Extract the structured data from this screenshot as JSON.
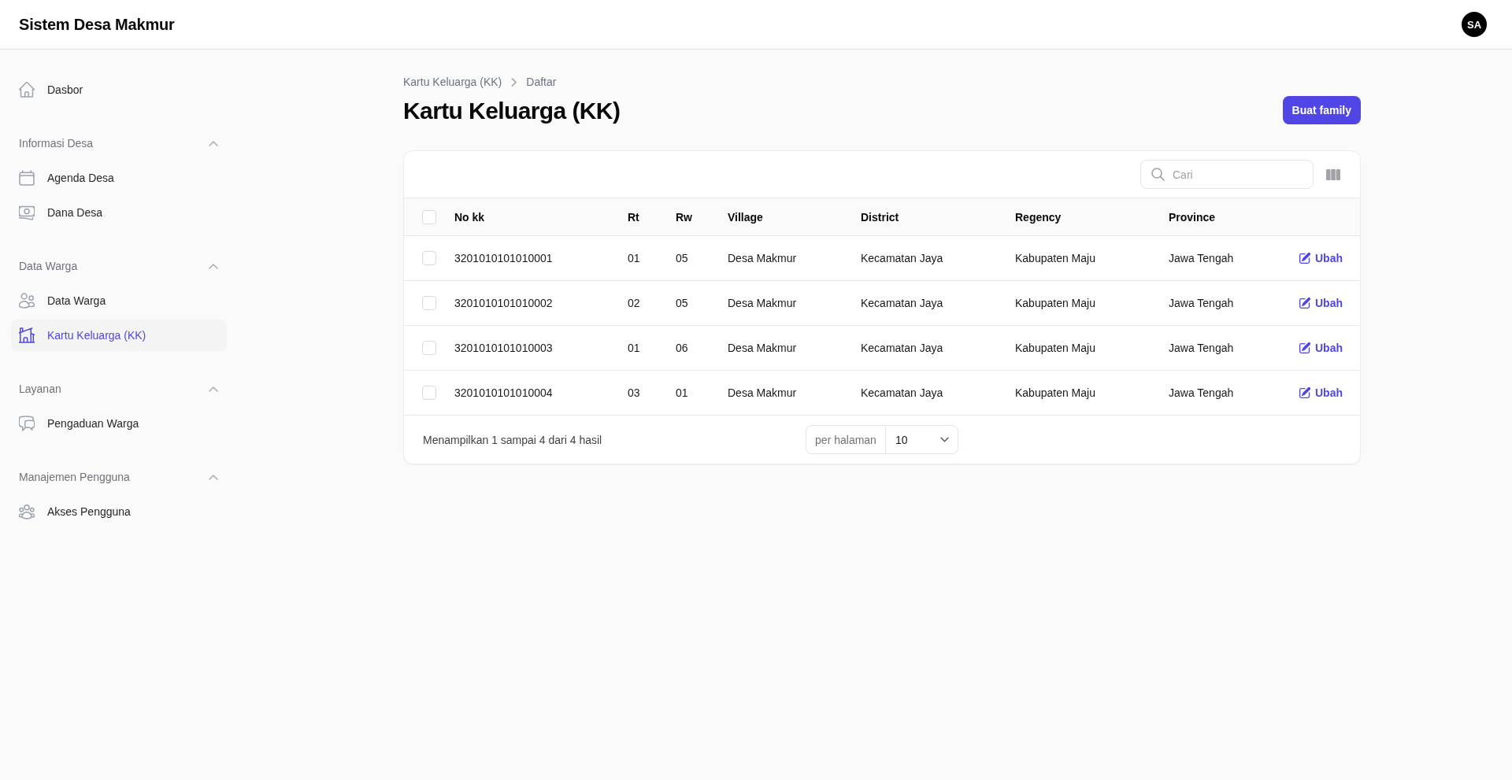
{
  "topbar": {
    "title": "Sistem Desa Makmur",
    "avatar": "SA"
  },
  "sidebar": {
    "sections": [
      {
        "items": [
          {
            "label": "Dasbor",
            "selected": false
          }
        ]
      },
      {
        "heading": "Informasi Desa",
        "expanded": true,
        "items": [
          {
            "label": "Agenda Desa",
            "selected": false
          },
          {
            "label": "Dana Desa",
            "selected": false
          }
        ]
      },
      {
        "heading": "Data Warga",
        "expanded": true,
        "items": [
          {
            "label": "Data Warga",
            "selected": false
          },
          {
            "label": "Kartu Keluarga (KK)",
            "selected": true
          }
        ]
      },
      {
        "heading": "Layanan",
        "expanded": true,
        "items": [
          {
            "label": "Pengaduan Warga",
            "selected": false
          }
        ]
      },
      {
        "heading": "Manajemen Pengguna",
        "expanded": true,
        "items": [
          {
            "label": "Akses Pengguna",
            "selected": false
          }
        ]
      }
    ]
  },
  "breadcrumb": [
    "Kartu Keluarga (KK)",
    "Daftar"
  ],
  "page": {
    "title": "Kartu Keluarga (KK)",
    "create_button": "Buat family"
  },
  "table": {
    "search": {
      "placeholder": "Cari"
    },
    "select_all": {
      "checked": false
    },
    "columns": [
      "No kk",
      "Rt",
      "Rw",
      "Village",
      "District",
      "Regency",
      "Province"
    ],
    "rows": [
      {
        "checked": false,
        "cells": [
          "3201010101010001",
          "01",
          "05",
          "Desa Makmur",
          "Kecamatan Jaya",
          "Kabupaten Maju",
          "Jawa Tengah"
        ],
        "action": "Ubah"
      },
      {
        "checked": false,
        "cells": [
          "3201010101010002",
          "02",
          "05",
          "Desa Makmur",
          "Kecamatan Jaya",
          "Kabupaten Maju",
          "Jawa Tengah"
        ],
        "action": "Ubah"
      },
      {
        "checked": false,
        "cells": [
          "3201010101010003",
          "01",
          "06",
          "Desa Makmur",
          "Kecamatan Jaya",
          "Kabupaten Maju",
          "Jawa Tengah"
        ],
        "action": "Ubah"
      },
      {
        "checked": false,
        "cells": [
          "3201010101010004",
          "03",
          "01",
          "Desa Makmur",
          "Kecamatan Jaya",
          "Kabupaten Maju",
          "Jawa Tengah"
        ],
        "action": "Ubah"
      }
    ],
    "footer": {
      "summary": "Menampilkan 1 sampai 4 dari 4 hasil",
      "per_page": {
        "label": "per halaman",
        "value": "10"
      }
    }
  }
}
